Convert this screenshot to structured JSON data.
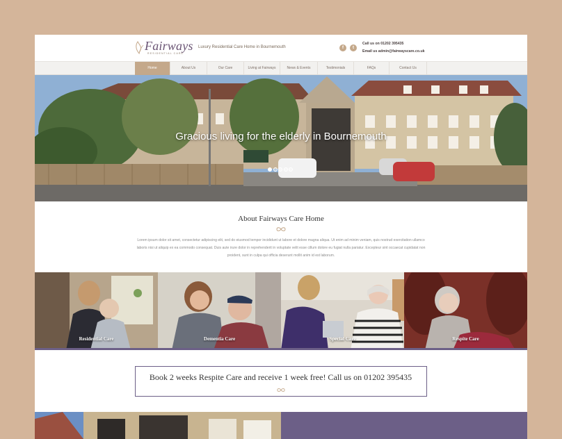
{
  "header": {
    "logo_word": "Fairways",
    "logo_sub": "RESIDENTIAL CARE",
    "tagline": "Luxury Residential Care Home in Bournemouth",
    "phone": "Call us on 01202 395435",
    "email": "Email us admin@fairwayscare.co.uk",
    "social": [
      {
        "icon": "facebook-icon",
        "glyph": "f"
      },
      {
        "icon": "twitter-icon",
        "glyph": "t"
      }
    ]
  },
  "nav": {
    "items": [
      {
        "label": "Home",
        "active": true
      },
      {
        "label": "About Us"
      },
      {
        "label": "Our Care"
      },
      {
        "label": "Living at Fairways"
      },
      {
        "label": "News & Events"
      },
      {
        "label": "Testimonials"
      },
      {
        "label": "FAQs"
      },
      {
        "label": "Contact Us"
      }
    ]
  },
  "hero": {
    "title": "Gracious living for the elderly in Bournemouth",
    "slide_count": 5,
    "active_slide": 1
  },
  "about": {
    "title": "About Fairways Care Home",
    "text": "Lorem ipsum dolor sit amet, consectetur adipiscing elit, sed do eiusmod tempor incididunt ut labore et dolore magna aliqua. Ut enim ad minim veniam, quis nostrud exercitation ullamco laboris nisi ut aliquip ex ea commodo consequat. Duis aute irure dolor in reprehenderit in voluptate velit esse cillum dolore eu fugiat nulla pariatur. Excepteur sint occaecat cupidatat non proident, sunt in culpa qui officia deserunt mollit anim id est laborum."
  },
  "services": [
    {
      "label": "Residential Care"
    },
    {
      "label": "Dementia Care"
    },
    {
      "label": "Special Care"
    },
    {
      "label": "Respite Care"
    }
  ],
  "promo": {
    "text": "Book 2 weeks Respite Care and receive 1 week free! Call us on 01202 395435"
  },
  "colors": {
    "background": "#d4b59a",
    "accent": "#c4a88a",
    "brand_purple": "#6c5f87"
  }
}
